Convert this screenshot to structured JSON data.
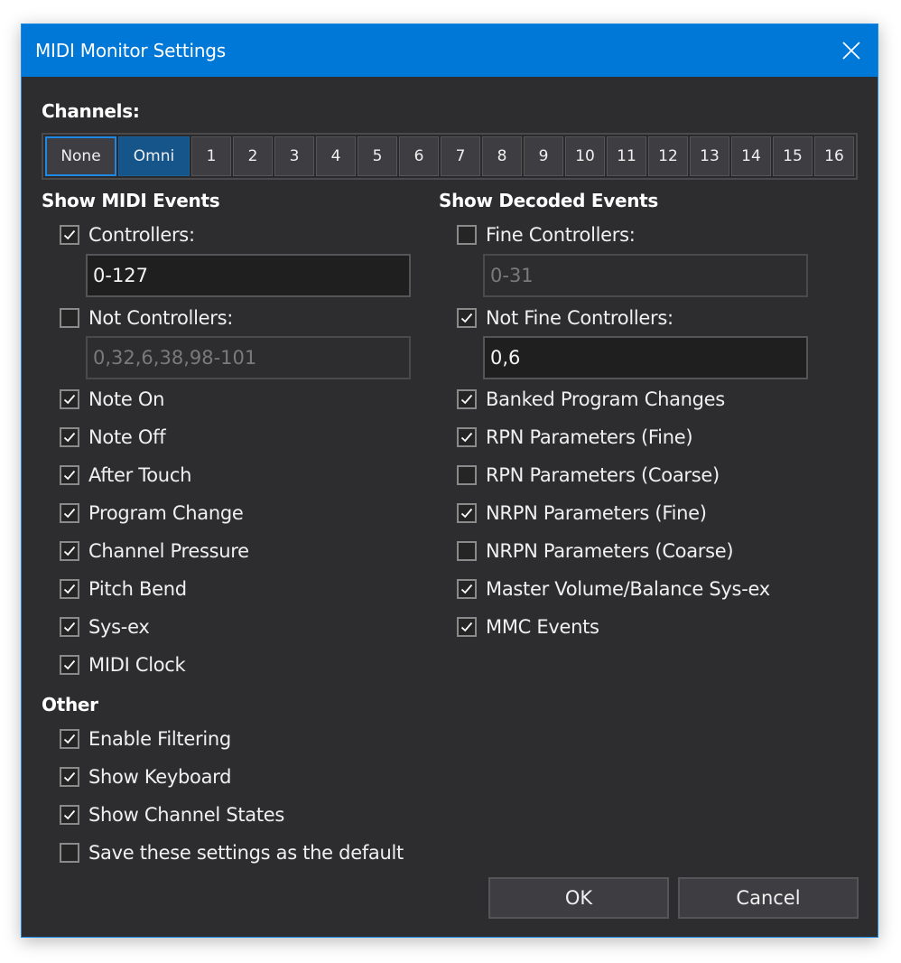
{
  "window": {
    "title": "MIDI Monitor Settings",
    "close_icon": "close-icon"
  },
  "colors": {
    "titlebar": "#0078d7",
    "background": "#2d2d30",
    "selected_channel": "#15558a",
    "focus_border": "#1e88e5"
  },
  "channels": {
    "label": "Channels:",
    "buttons": [
      {
        "label": "None",
        "selected": false,
        "focused": true
      },
      {
        "label": "Omni",
        "selected": true,
        "focused": false
      },
      {
        "label": "1",
        "selected": false
      },
      {
        "label": "2",
        "selected": false
      },
      {
        "label": "3",
        "selected": false
      },
      {
        "label": "4",
        "selected": false
      },
      {
        "label": "5",
        "selected": false
      },
      {
        "label": "6",
        "selected": false
      },
      {
        "label": "7",
        "selected": false
      },
      {
        "label": "8",
        "selected": false
      },
      {
        "label": "9",
        "selected": false
      },
      {
        "label": "10",
        "selected": false
      },
      {
        "label": "11",
        "selected": false
      },
      {
        "label": "12",
        "selected": false
      },
      {
        "label": "13",
        "selected": false
      },
      {
        "label": "14",
        "selected": false
      },
      {
        "label": "15",
        "selected": false
      },
      {
        "label": "16",
        "selected": false
      }
    ]
  },
  "midi_events": {
    "heading": "Show MIDI Events",
    "controllers": {
      "label": "Controllers:",
      "checked": true,
      "value": "0-127"
    },
    "not_controllers": {
      "label": "Not Controllers:",
      "checked": false,
      "value": "0,32,6,38,98-101"
    },
    "items": [
      {
        "label": "Note On",
        "checked": true
      },
      {
        "label": "Note Off",
        "checked": true
      },
      {
        "label": "After Touch",
        "checked": true
      },
      {
        "label": "Program Change",
        "checked": true
      },
      {
        "label": "Channel Pressure",
        "checked": true
      },
      {
        "label": "Pitch Bend",
        "checked": true
      },
      {
        "label": "Sys-ex",
        "checked": true
      },
      {
        "label": "MIDI Clock",
        "checked": true
      }
    ]
  },
  "decoded_events": {
    "heading": "Show Decoded Events",
    "fine_controllers": {
      "label": "Fine Controllers:",
      "checked": false,
      "value": "0-31"
    },
    "not_fine_controllers": {
      "label": "Not Fine Controllers:",
      "checked": true,
      "value": "0,6"
    },
    "items": [
      {
        "label": "Banked Program Changes",
        "checked": true
      },
      {
        "label": "RPN Parameters (Fine)",
        "checked": true
      },
      {
        "label": "RPN Parameters (Coarse)",
        "checked": false
      },
      {
        "label": "NRPN Parameters (Fine)",
        "checked": true
      },
      {
        "label": "NRPN Parameters (Coarse)",
        "checked": false
      },
      {
        "label": "Master Volume/Balance Sys-ex",
        "checked": true
      },
      {
        "label": "MMC Events",
        "checked": true
      }
    ]
  },
  "other": {
    "heading": "Other",
    "items": [
      {
        "label": "Enable Filtering",
        "checked": true
      },
      {
        "label": "Show Keyboard",
        "checked": true
      },
      {
        "label": "Show Channel States",
        "checked": true
      },
      {
        "label": "Save these settings as the default",
        "checked": false
      }
    ]
  },
  "buttons": {
    "ok": "OK",
    "cancel": "Cancel"
  }
}
